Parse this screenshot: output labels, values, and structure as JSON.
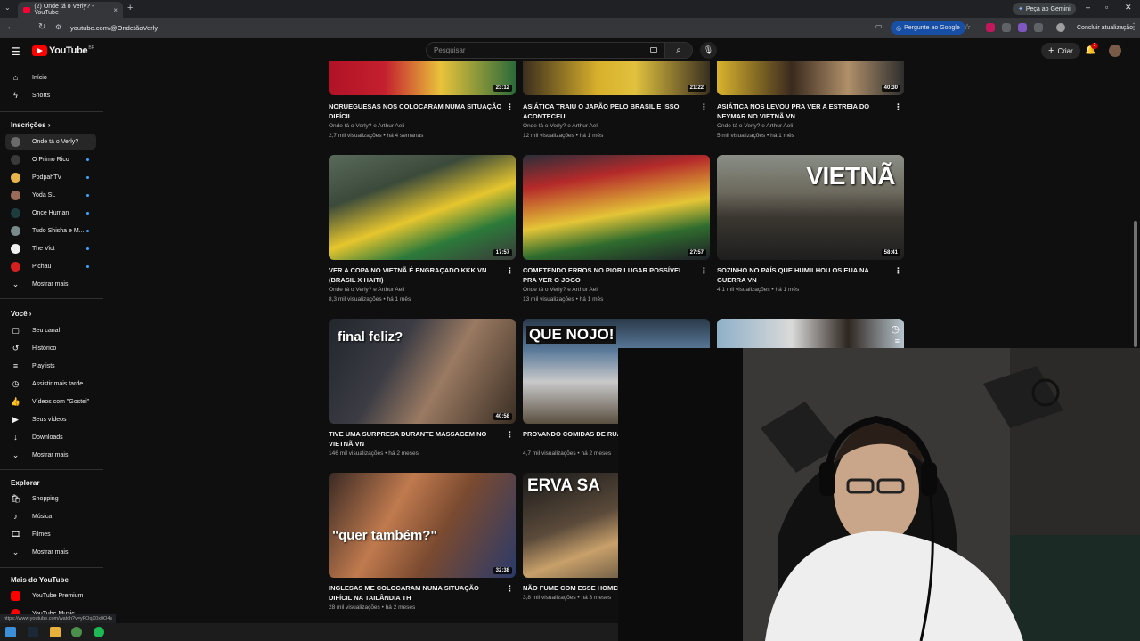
{
  "browser": {
    "tab_title": "(2) Onde tá o Verly? - YouTube",
    "url": "youtube.com/@OndetãoVerly",
    "gemini_label": "Peça ao Gemini",
    "ask_google_label": "Pergunte ao Google",
    "update_label": "Concluir atualização"
  },
  "header": {
    "logo_text": "YouTube",
    "logo_region": "BR",
    "search_placeholder": "Pesquisar",
    "create_label": "Criar",
    "notif_count": "2"
  },
  "sidebar": {
    "main": [
      {
        "label": "Início"
      },
      {
        "label": "Shorts"
      }
    ],
    "subs_header": "Inscrições",
    "subs": [
      {
        "label": "Onde tá o Verly?",
        "color": "#6b6b6b"
      },
      {
        "label": "O Primo Rico",
        "color": "#3a3a3a"
      },
      {
        "label": "PodpahTV",
        "color": "#e8b54a"
      },
      {
        "label": "Yoda SL",
        "color": "#9a6a5a"
      },
      {
        "label": "Once Human",
        "color": "#1d3d3d"
      },
      {
        "label": "Tudo Shisha e M...",
        "color": "#7a8a8a"
      },
      {
        "label": "The Vict",
        "color": "#f1f1f1"
      },
      {
        "label": "Pichau",
        "color": "#d42020"
      }
    ],
    "subs_more": "Mostrar mais",
    "you_header": "Você",
    "you": [
      {
        "label": "Seu canal",
        "icon": "▢"
      },
      {
        "label": "Histórico",
        "icon": "↺"
      },
      {
        "label": "Playlists",
        "icon": "≡"
      },
      {
        "label": "Assistir mais tarde",
        "icon": "◷"
      },
      {
        "label": "Vídeos com \"Gostei\"",
        "icon": "👍"
      },
      {
        "label": "Seus vídeos",
        "icon": "▶"
      },
      {
        "label": "Downloads",
        "icon": "↓"
      }
    ],
    "you_more": "Mostrar mais",
    "explore_header": "Explorar",
    "explore": [
      {
        "label": "Shopping",
        "icon": "🛍"
      },
      {
        "label": "Música",
        "icon": "♪"
      },
      {
        "label": "Filmes",
        "icon": "🎞"
      }
    ],
    "explore_more": "Mostrar mais",
    "more_header": "Mais do YouTube",
    "more": [
      {
        "label": "YouTube Premium"
      },
      {
        "label": "YouTube Music"
      }
    ]
  },
  "videos": [
    {
      "title": "NORUEGUESAS NOS COLOCARAM NUMA SITUAÇÃO DIFÍCIL",
      "channel": "Onde tá o Verly? e Arthur Aeli",
      "meta": "2,7 mil visualizações • há 4 semanas",
      "duration": "23:12"
    },
    {
      "title": "ASIÁTICA TRAIU O JAPÃO PELO BRASIL E ISSO ACONTECEU",
      "channel": "Onde tá o Verly? e Arthur Aeli",
      "meta": "12 mil visualizações • há 1 mês",
      "duration": "21:22"
    },
    {
      "title": "ASIÁTICA NOS LEVOU PRA VER A ESTREIA DO NEYMAR NO VIETNÃ VN",
      "channel": "Onde tá o Verly? e Arthur Aeli",
      "meta": "5 mil visualizações • há 1 mês",
      "duration": "40:30"
    },
    {
      "title": "VER A COPA NO VIETNÃ É ENGRAÇADO KKK VN (BRASIL X HAITI)",
      "channel": "Onde tá o Verly? e Arthur Aeli",
      "meta": "8,3 mil visualizações • há 1 mês",
      "duration": "17:57"
    },
    {
      "title": "COMETENDO ERROS NO PIOR LUGAR POSSÍVEL PRA VER O JOGO",
      "channel": "Onde tá o Verly? e Arthur Aeli",
      "meta": "13 mil visualizações • há 1 mês",
      "duration": "27:57"
    },
    {
      "title": "SOZINHO NO PAÍS QUE HUMILHOU OS EUA NA GUERRA VN",
      "channel": "",
      "meta": "4,1 mil visualizações • há 1 mês",
      "duration": "58:41",
      "overlay": "VIETNÃ"
    },
    {
      "title": "TIVE UMA SURPRESA DURANTE MASSAGEM NO VIETNÃ VN",
      "channel": "",
      "meta": "146 mil visualizações • há 2 meses",
      "duration": "40:58",
      "overlay": "final feliz?"
    },
    {
      "title": "PROVANDO COMIDAS DE RUA RUIM VN",
      "channel": "",
      "meta": "4,7 mil visualizações • há 2 meses",
      "duration": "",
      "overlay": "QUE NOJO!"
    },
    {
      "title": "",
      "channel": "",
      "meta": "",
      "duration": ""
    },
    {
      "title": "INGLESAS ME COLOCARAM NUMA SITUAÇÃO DIFÍCIL NA TAILÂNDIA TH",
      "channel": "",
      "meta": "28 mil visualizações • há 2 meses",
      "duration": "32:38",
      "overlay": "\"quer também?\""
    },
    {
      "title": "NÃO FUME COM ESSE HOMEM",
      "channel": "",
      "meta": "3,8 mil visualizações • há 3 meses",
      "duration": "",
      "overlay": "ERVA SA"
    }
  ],
  "status_url": "https://www.youtube.com/watch?v=yFOqX0x0O4s"
}
